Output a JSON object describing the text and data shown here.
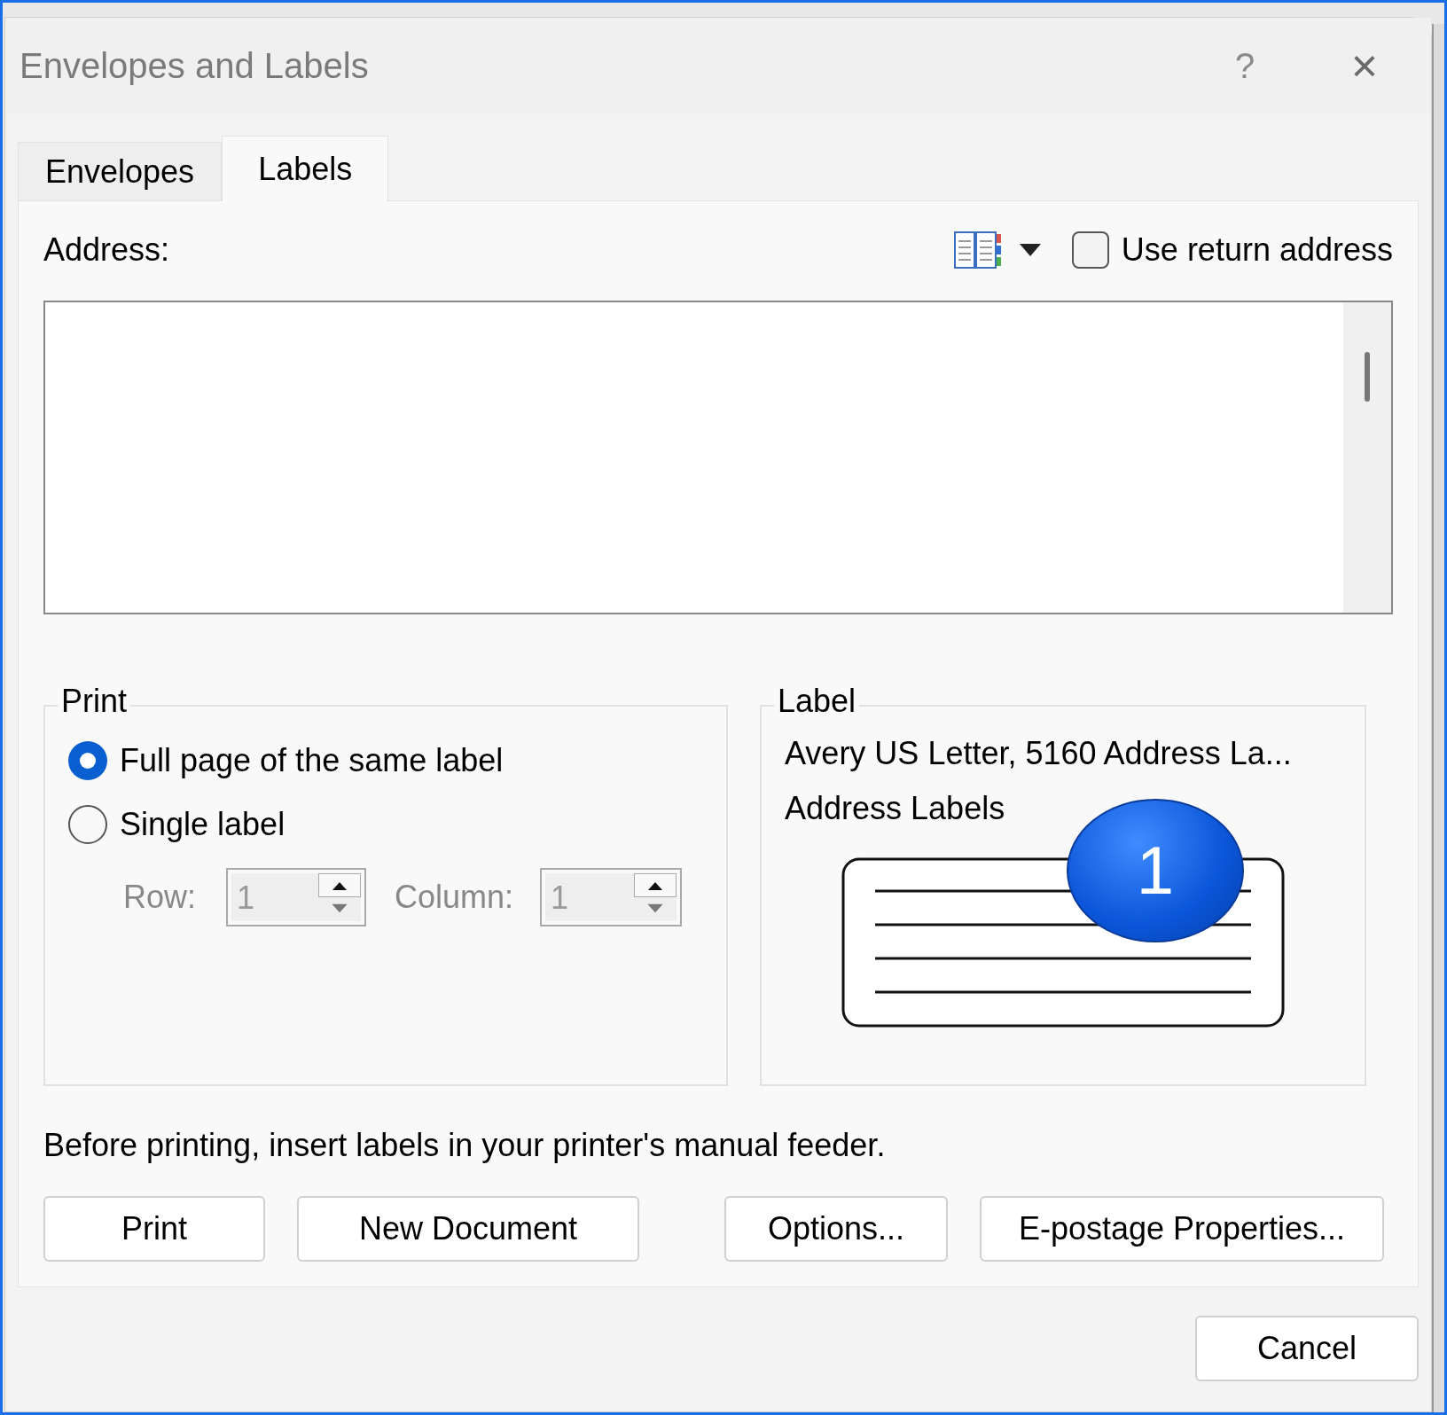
{
  "window": {
    "title": "Envelopes and Labels",
    "help": "?",
    "close": "×"
  },
  "tabs": [
    {
      "label": "Envelopes",
      "selected": false
    },
    {
      "label": "Labels",
      "selected": true
    }
  ],
  "address": {
    "label": "Address:",
    "use_return_address": {
      "label": "Use return address",
      "checked": false
    }
  },
  "print_group": {
    "title": "Print",
    "options": [
      {
        "label": "Full page of the same label",
        "selected": true
      },
      {
        "label": "Single label",
        "selected": false
      }
    ],
    "row": {
      "label": "Row:",
      "value": "1",
      "disabled": true
    },
    "column": {
      "label": "Column:",
      "value": "1",
      "disabled": true
    }
  },
  "label_group": {
    "title": "Label",
    "lines": [
      "Avery US Letter, 5160 Address La...",
      "Address Labels"
    ]
  },
  "callout": "1",
  "note": "Before printing, insert labels in your printer's manual feeder.",
  "buttons": [
    {
      "label": "Print"
    },
    {
      "label": "New Document"
    },
    {
      "label": "Options..."
    },
    {
      "label": "E-postage Properties..."
    }
  ],
  "footer_buttons": [
    {
      "label": "Cancel"
    }
  ]
}
